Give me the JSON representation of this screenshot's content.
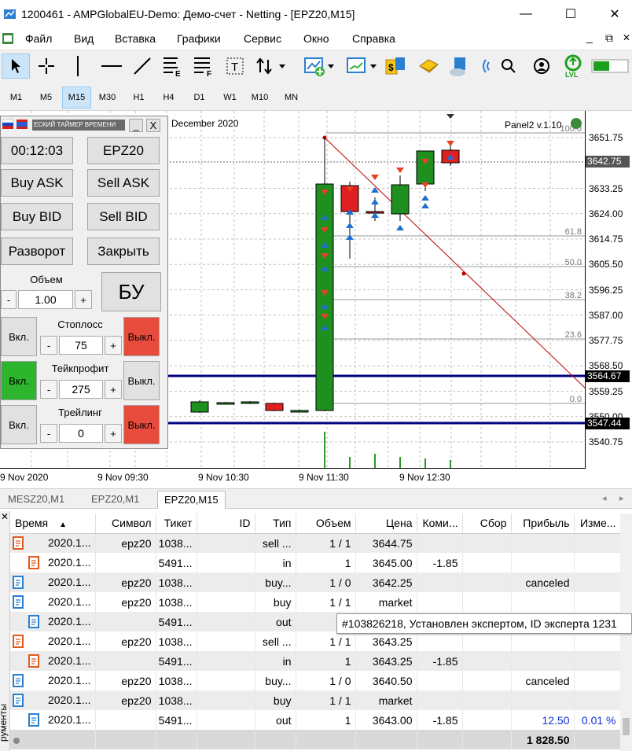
{
  "window": {
    "title": "1200461 - AMPGlobalEU-Demo: Демо-счет - Netting - [EPZ20,M15]",
    "minimize": "—",
    "maximize": "☐",
    "close": "✕"
  },
  "menu": {
    "items": [
      "Файл",
      "Вид",
      "Вставка",
      "Графики",
      "Сервис",
      "Окно",
      "Справка"
    ],
    "mdi": [
      "_",
      "⧉",
      "✕"
    ]
  },
  "toolbar": {
    "icons": [
      "cursor-icon",
      "crosshair-icon",
      "vertical-line-icon",
      "horizontal-line-icon",
      "trendline-icon",
      "fibonacci-icon",
      "text-label-icon",
      "arrows-icon",
      "new-chart-icon",
      "indicator-icon",
      "market-icon",
      "signals-icon",
      "vps-icon",
      "radio-icon",
      "search-icon",
      "account-icon",
      "level-icon",
      "battery-icon"
    ]
  },
  "timeframes": {
    "items": [
      "M1",
      "M5",
      "M15",
      "M30",
      "H1",
      "H4",
      "D1",
      "W1",
      "M10",
      "MN"
    ],
    "selected": "M15"
  },
  "chart": {
    "header": "December 2020",
    "panel_label": "Panel2 v.1.10",
    "fib_levels": [
      "100.0",
      "61.8",
      "50.0",
      "38.2",
      "23.6",
      "0.0"
    ],
    "yticks": [
      "3651.75",
      "3633.25",
      "3624.00",
      "3614.75",
      "3605.50",
      "3596.25",
      "3587.00",
      "3577.75",
      "3568.50",
      "3559.25",
      "3550.00",
      "3540.75"
    ],
    "tags": [
      "3642.75",
      "3564.67",
      "3547.44"
    ],
    "xticks": [
      "9 Nov 2020",
      "9 Nov 09:30",
      "9 Nov 10:30",
      "9 Nov 11:30",
      "9 Nov 12:30"
    ]
  },
  "panel": {
    "title": "ЕСКИЙ ТАЙМЕР ВРЕМЕНИ",
    "title_btn_min": "_",
    "title_btn_close": "X",
    "timer": "00:12:03",
    "symbol": "EPZ20",
    "buy_ask": "Buy ASK",
    "sell_ask": "Sell ASK",
    "buy_bid": "Buy BID",
    "sell_bid": "Sell BID",
    "reverse": "Разворот",
    "close": "Закрыть",
    "volume_label": "Объем",
    "volume": "1.00",
    "bu": "БУ",
    "minus": "-",
    "plus": "+",
    "on": "Вкл.",
    "off": "Выкл.",
    "stoploss_label": "Стоплосс",
    "stoploss": "75",
    "takeprofit_label": "Тейкпрофит",
    "takeprofit": "275",
    "trailing_label": "Трейлинг",
    "trailing": "0"
  },
  "tabs": {
    "items": [
      "MESZ20,M1",
      "EPZ20,M1",
      "EPZ20,M15"
    ],
    "active": "EPZ20,M15"
  },
  "table": {
    "headers": [
      "Время",
      "Символ",
      "Тикет",
      "ID",
      "Тип",
      "Объем",
      "Цена",
      "Коми...",
      "Сбор",
      "Прибыль",
      "Изме..."
    ],
    "rows": [
      {
        "time": "2020.1...",
        "symbol": "epz20",
        "ticket": "1038...",
        "id": "",
        "type": "sell ...",
        "volume": "1 / 1",
        "price": "3644.75",
        "commission": "",
        "fee": "",
        "profit": "",
        "change": ""
      },
      {
        "time": "2020.1...",
        "symbol": "",
        "ticket": "5491...",
        "id": "",
        "type": "in",
        "volume": "1",
        "price": "3645.00",
        "commission": "-1.85",
        "fee": "",
        "profit": "",
        "change": ""
      },
      {
        "time": "2020.1...",
        "symbol": "epz20",
        "ticket": "1038...",
        "id": "",
        "type": "buy...",
        "volume": "1 / 0",
        "price": "3642.25",
        "commission": "",
        "fee": "",
        "profit": "canceled",
        "change": ""
      },
      {
        "time": "2020.1...",
        "symbol": "epz20",
        "ticket": "1038...",
        "id": "",
        "type": "buy",
        "volume": "1 / 1",
        "price": "market",
        "commission": "",
        "fee": "",
        "profit": "",
        "change": ""
      },
      {
        "time": "2020.1...",
        "symbol": "",
        "ticket": "5491...",
        "id": "",
        "type": "out",
        "volume": "",
        "price": "",
        "commission": "",
        "fee": "",
        "profit": "",
        "change": ""
      },
      {
        "time": "2020.1...",
        "symbol": "epz20",
        "ticket": "1038...",
        "id": "",
        "type": "sell ...",
        "volume": "1 / 1",
        "price": "3643.25",
        "commission": "",
        "fee": "",
        "profit": "",
        "change": ""
      },
      {
        "time": "2020.1...",
        "symbol": "",
        "ticket": "5491...",
        "id": "",
        "type": "in",
        "volume": "1",
        "price": "3643.25",
        "commission": "-1.85",
        "fee": "",
        "profit": "",
        "change": ""
      },
      {
        "time": "2020.1...",
        "symbol": "epz20",
        "ticket": "1038...",
        "id": "",
        "type": "buy...",
        "volume": "1 / 0",
        "price": "3640.50",
        "commission": "",
        "fee": "",
        "profit": "canceled",
        "change": ""
      },
      {
        "time": "2020.1...",
        "symbol": "epz20",
        "ticket": "1038...",
        "id": "",
        "type": "buy",
        "volume": "1 / 1",
        "price": "market",
        "commission": "",
        "fee": "",
        "profit": "",
        "change": ""
      },
      {
        "time": "2020.1...",
        "symbol": "",
        "ticket": "5491...",
        "id": "",
        "type": "out",
        "volume": "1",
        "price": "3643.00",
        "commission": "-1.85",
        "fee": "",
        "profit": "12.50",
        "change": "0.01 %"
      }
    ],
    "total": "1 828.50"
  },
  "tooltip": "#103826218, Установлен экспертом, ID эксперта 1231",
  "sidebar_label": "рументы",
  "colors": {
    "up": "#1f8f1f",
    "down": "#e02020",
    "grid": "#c0c0c0",
    "navy": "#000080"
  }
}
